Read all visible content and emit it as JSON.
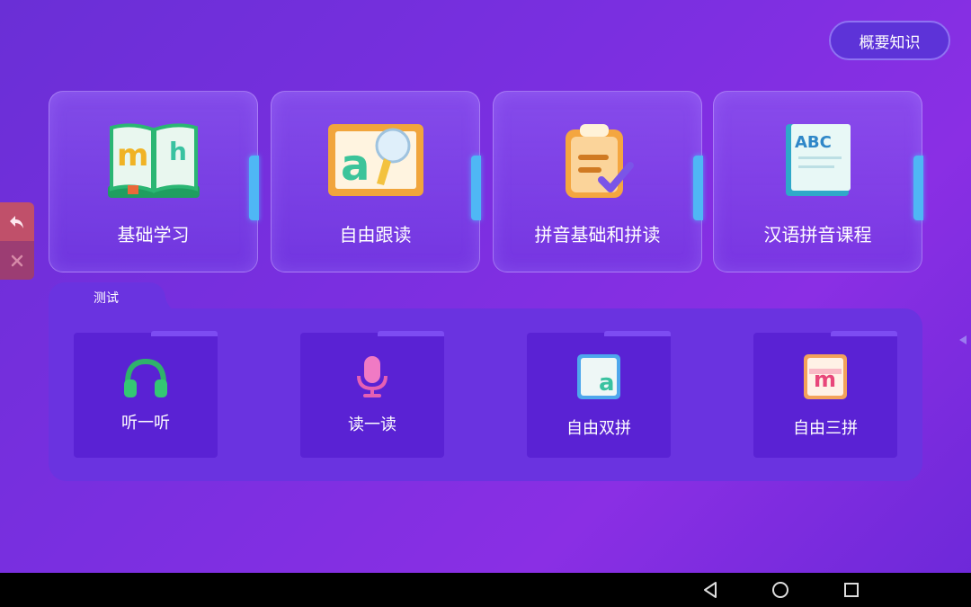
{
  "header": {
    "overview_button": "概要知识"
  },
  "cards": [
    {
      "label": "基础学习",
      "icon": "book-mh-icon"
    },
    {
      "label": "自由跟读",
      "icon": "board-microphone-icon"
    },
    {
      "label": "拼音基础和拼读",
      "icon": "clipboard-check-icon"
    },
    {
      "label": "汉语拼音课程",
      "icon": "abc-book-icon"
    }
  ],
  "test": {
    "tab_label": "测试",
    "tiles": [
      {
        "label": "听一听",
        "icon": "headphones-icon"
      },
      {
        "label": "读一读",
        "icon": "microphone-icon"
      },
      {
        "label": "自由双拼",
        "icon": "letter-a-card-icon"
      },
      {
        "label": "自由三拼",
        "icon": "letter-m-card-icon"
      }
    ]
  },
  "side": {
    "back_icon": "undo-icon",
    "close_icon": "close-icon"
  },
  "navbar": {
    "back": "nav-back-icon",
    "home": "nav-home-icon",
    "recents": "nav-recents-icon"
  }
}
